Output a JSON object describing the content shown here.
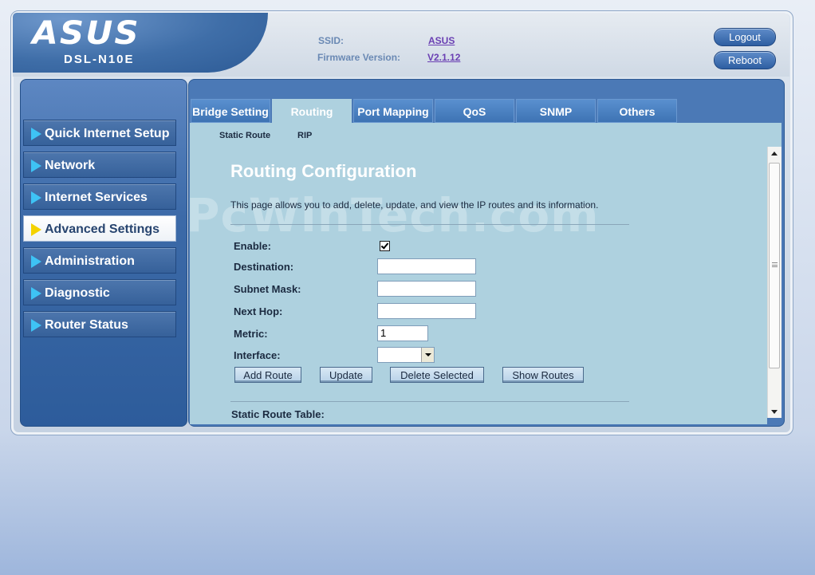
{
  "header": {
    "brand": "ASUS",
    "model": "DSL-N10E",
    "ssid_label": "SSID:",
    "ssid_value": "ASUS",
    "firmware_label": "Firmware Version:",
    "firmware_value": "V2.1.12",
    "logout": "Logout",
    "reboot": "Reboot"
  },
  "sidebar": {
    "items": [
      {
        "label": "Quick Internet Setup"
      },
      {
        "label": "Network"
      },
      {
        "label": "Internet Services"
      },
      {
        "label": "Advanced Settings",
        "active": true
      },
      {
        "label": "Administration"
      },
      {
        "label": "Diagnostic"
      },
      {
        "label": "Router Status"
      }
    ]
  },
  "tabs": [
    {
      "label": "Bridge Setting"
    },
    {
      "label": "Routing",
      "active": true
    },
    {
      "label": "Port Mapping"
    },
    {
      "label": "QoS"
    },
    {
      "label": "SNMP"
    },
    {
      "label": "Others"
    }
  ],
  "subtabs": [
    {
      "label": "Static Route"
    },
    {
      "label": "RIP"
    }
  ],
  "watermark": "PcWinTech.com",
  "main": {
    "title": "Routing Configuration",
    "description": "This page allows you to add, delete, update, and view the IP routes and its information.",
    "form": {
      "enable_label": "Enable:",
      "enable_checked": true,
      "destination_label": "Destination:",
      "destination_value": "",
      "subnet_label": "Subnet Mask:",
      "subnet_value": "",
      "nexthop_label": "Next Hop:",
      "nexthop_value": "",
      "metric_label": "Metric:",
      "metric_value": "1",
      "interface_label": "Interface:",
      "interface_value": ""
    },
    "buttons": {
      "add_route": "Add Route",
      "update": "Update",
      "delete_selected": "Delete Selected",
      "show_routes": "Show Routes"
    },
    "table_title": "Static Route Table:"
  },
  "colors": {
    "accent": "#3e73b4",
    "content_bg": "#aed1df",
    "active_arrow": "#f4d200",
    "nav_arrow": "#3ec3f5"
  }
}
